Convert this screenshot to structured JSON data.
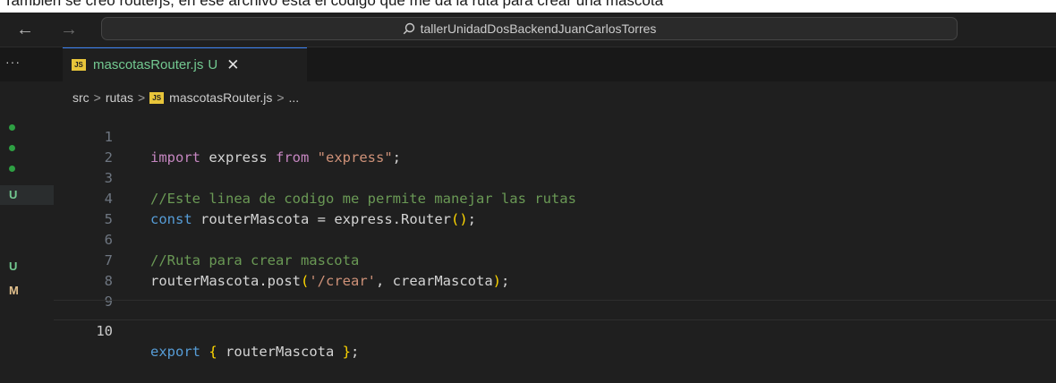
{
  "caption": "Tambien se creo routerjs, en ese archivo esta el codigo que me da la ruta para crear una mascota",
  "titlebar": {
    "back": "←",
    "forward": "→",
    "search_text": "tallerUnidadDosBackendJuanCarlosTorres"
  },
  "tabs": {
    "more": "···",
    "file_badge": "JS",
    "file_name": "mascotasRouter.js",
    "status": "U",
    "close": "✕"
  },
  "breadcrumb": {
    "items": [
      "src",
      "rutas",
      "mascotasRouter.js",
      "..."
    ],
    "separator": ">"
  },
  "scm_markers": [
    {
      "type": "dot",
      "label": ""
    },
    {
      "type": "dot",
      "label": ""
    },
    {
      "type": "dot",
      "label": ""
    },
    {
      "type": "letter",
      "label": "U"
    },
    {
      "type": "letter",
      "label": "U"
    },
    {
      "type": "letter",
      "label": "M"
    }
  ],
  "code": {
    "line_numbers": [
      "1",
      "2",
      "3",
      "4",
      "5",
      "6",
      "7",
      "8",
      "9",
      "10"
    ],
    "l1": {
      "kw": "import",
      "id": " express ",
      "from": "from",
      "str": "\"express\"",
      "end": ";"
    },
    "l3": {
      "comment": "//Este linea de codigo me permite manejar las rutas"
    },
    "l4": {
      "kw": "const",
      "var": " routerMascota ",
      "eq": "= ",
      "obj": "express",
      "dot": ".",
      "fn": "Router",
      "paren": "()",
      "end": ";"
    },
    "l6": {
      "comment": "//Ruta para crear mascota"
    },
    "l7": {
      "obj": "routerMascota",
      "dot": ".",
      "fn": "post",
      "open": "(",
      "str": "'/crear'",
      "comma": ", ",
      "arg": "crearMascota",
      "close": ")",
      "end": ";"
    },
    "l10": {
      "kw": "export",
      "sp": " ",
      "open": "{",
      "id": " routerMascota ",
      "close": "}",
      "end": ";"
    }
  }
}
